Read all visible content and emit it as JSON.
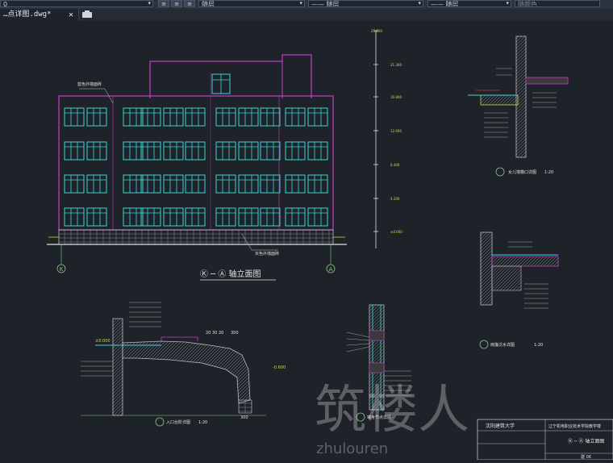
{
  "toolbar": {
    "layer_value": "0",
    "color_value": "随层",
    "linetype1_value": "—— 随层",
    "linetype2_value": "—— 随层",
    "plotstyle_value": "随颜色"
  },
  "tabs": [
    {
      "label": "…点详图.dwg*"
    }
  ],
  "drawing": {
    "elevation_title": "Ⓚ ─ Ⓐ 轴立面图",
    "axis_left": "K",
    "axis_right": "A",
    "annot_top": "蓝色外墙面砖",
    "annot_bottom": "灰色外墙面砖",
    "dim_total": "25,200",
    "dim_levels": [
      "21.300",
      "16.800",
      "12.600",
      "8.400",
      "4.200",
      "±0.000"
    ],
    "detail1_title": "女儿墙檐口详图",
    "detail1_scale": "1:20",
    "detail2_title": "雨篷泛水详图",
    "detail2_scale": "1:20",
    "detail3_title": "墙身节点详图",
    "detail4_title": "入口台阶详图",
    "detail4_scale": "1:20",
    "dims_steps": [
      "20",
      "30",
      "20",
      "300"
    ],
    "level_entry": "±0.000",
    "level_step": "-0.600",
    "dim_bottom": "300",
    "title_block": {
      "school": "沈阳建筑大学",
      "project": "辽宁机电职业技术学院教学楼",
      "sheet": "Ⓚ ─ Ⓐ 轴立面图",
      "sheet_no": "建 06"
    },
    "watermark_cn": "筑楼人",
    "watermark_en": "zhulouren"
  }
}
